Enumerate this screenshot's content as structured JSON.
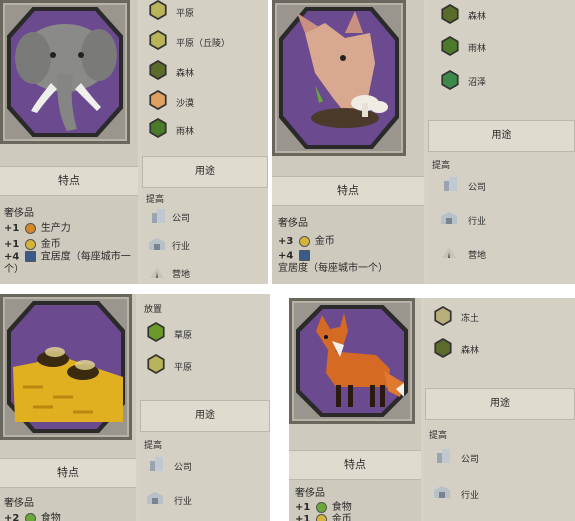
{
  "cards": [
    {
      "id": "elephant",
      "portrait": "elephant-portrait",
      "traits_title": "特点",
      "luxury_label": "奢侈品",
      "stats": [
        {
          "num": "+1",
          "icon": "production-icon",
          "color": "#d8862a",
          "text": "生产力"
        },
        {
          "num": "+1",
          "icon": "gold-icon",
          "color": "#d4b43a",
          "text": "金币"
        },
        {
          "num": "+4",
          "icon": "amenity-icon",
          "color": "#3a5a8a",
          "text": "宜居度（每座城市一个）"
        }
      ],
      "terrains": [
        {
          "label": "平原",
          "color": "#b9b45a"
        },
        {
          "label": "平原（丘陵）",
          "color": "#b9b45a"
        },
        {
          "label": "森林",
          "color": "#5b6b2a"
        },
        {
          "label": "沙漠",
          "color": "#e0a060"
        },
        {
          "label": "雨林",
          "color": "#4a7a2a"
        }
      ],
      "usage_title": "用途",
      "improve_label": "提高",
      "improvements": [
        {
          "label": "公司",
          "icon": "corporation-icon"
        },
        {
          "label": "行业",
          "icon": "industry-icon"
        },
        {
          "label": "营地",
          "icon": "camp-icon"
        }
      ]
    },
    {
      "id": "truffles",
      "portrait": "truffle-pig-portrait",
      "traits_title": "特点",
      "luxury_label": "奢侈品",
      "stats": [
        {
          "num": "+3",
          "icon": "gold-icon",
          "color": "#d4b43a",
          "text": "金币"
        },
        {
          "num": "+4",
          "icon": "amenity-icon",
          "color": "#3a5a8a",
          "text": "宜居度（每座城市一个）"
        }
      ],
      "terrains": [
        {
          "label": "森林",
          "color": "#5b6b2a"
        },
        {
          "label": "雨林",
          "color": "#4a7a2a"
        },
        {
          "label": "沼泽",
          "color": "#3e8a4a"
        }
      ],
      "usage_title": "用途",
      "improve_label": "提高",
      "improvements": [
        {
          "label": "公司",
          "icon": "corporation-icon"
        },
        {
          "label": "行业",
          "icon": "industry-icon"
        },
        {
          "label": "营地",
          "icon": "camp-icon"
        }
      ]
    },
    {
      "id": "honey",
      "portrait": "honey-bees-portrait",
      "traits_title": "特点",
      "luxury_label": "奢侈品",
      "stats": [
        {
          "num": "+2",
          "icon": "food-icon",
          "color": "#6aa83a",
          "text": "食物"
        }
      ],
      "place_label": "放置",
      "terrains": [
        {
          "label": "草原",
          "color": "#6a9a2a"
        },
        {
          "label": "平原",
          "color": "#b9b45a"
        }
      ],
      "usage_title": "用途",
      "improve_label": "提高",
      "improvements": [
        {
          "label": "公司",
          "icon": "corporation-icon"
        },
        {
          "label": "行业",
          "icon": "industry-icon"
        }
      ]
    },
    {
      "id": "furs",
      "portrait": "fox-portrait",
      "traits_title": "特点",
      "luxury_label": "奢侈品",
      "stats": [
        {
          "num": "+1",
          "icon": "food-icon",
          "color": "#6aa83a",
          "text": "食物"
        },
        {
          "num": "+1",
          "icon": "gold-icon",
          "color": "#d4b43a",
          "text": "金币"
        }
      ],
      "terrains": [
        {
          "label": "冻土",
          "color": "#b8b078"
        },
        {
          "label": "森林",
          "color": "#5b6b2a"
        }
      ],
      "usage_title": "用途",
      "improve_label": "提高",
      "improvements": [
        {
          "label": "公司",
          "icon": "corporation-icon"
        },
        {
          "label": "行业",
          "icon": "industry-icon"
        }
      ]
    }
  ]
}
